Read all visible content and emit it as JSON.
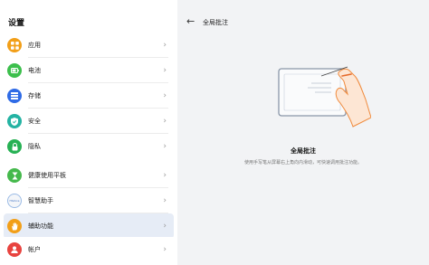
{
  "status": {
    "left": "▾",
    "right": "↗ ✱ ◉ ▣"
  },
  "sidebar": {
    "title": "设置",
    "items": [
      {
        "id": "apps",
        "label": "应用"
      },
      {
        "id": "battery",
        "label": "电池"
      },
      {
        "id": "storage",
        "label": "存储"
      },
      {
        "id": "security",
        "label": "安全"
      },
      {
        "id": "privacy",
        "label": "隐私"
      },
      {
        "id": "tablet",
        "label": "健康使用平板"
      },
      {
        "id": "assistant",
        "label": "智慧助手",
        "icon_text": "HiVoice"
      },
      {
        "id": "accessibility",
        "label": "辅助功能",
        "selected": true
      },
      {
        "id": "account",
        "label": "帐户"
      }
    ],
    "chevron": "›"
  },
  "main": {
    "back_icon": "←",
    "title": "全局批注",
    "feature_title": "全局批注",
    "feature_desc": "使用手写笔从屏幕右上角向内滑动，可快速调用批注功能。"
  },
  "colors": {
    "selected_bg": "#e6ecf6",
    "apps": "#f29f18",
    "battery": "#3cbf4c",
    "storage": "#2f6be6",
    "security": "#24b3a3",
    "privacy": "#27b154",
    "account": "#e8433f"
  }
}
